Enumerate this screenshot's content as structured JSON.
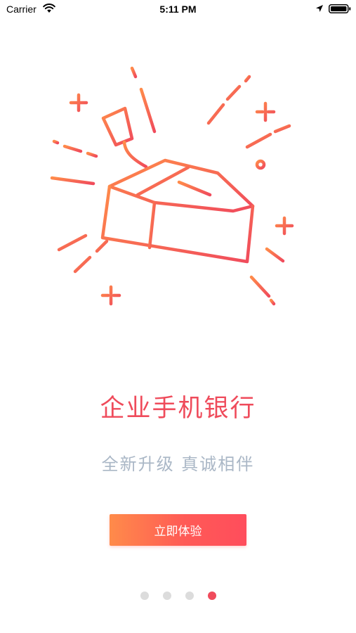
{
  "status_bar": {
    "carrier": "Carrier",
    "time": "5:11 PM",
    "icons": [
      "wifi-icon",
      "location-arrow-icon",
      "battery-icon"
    ]
  },
  "illustration": {
    "icon": "gift-box-burst-icon",
    "gradient": [
      "#ff8b4a",
      "#f04b5c"
    ]
  },
  "onboarding": {
    "title": "企业手机银行",
    "subtitle": "全新升级 真诚相伴",
    "cta_label": "立即体验"
  },
  "pager": {
    "page_count": 4,
    "current_page": 4
  },
  "colors": {
    "title": "#ef4b5b",
    "subtitle": "#aab7c6",
    "dot_inactive": "#dcdcdc",
    "dot_active": "#f04b5c"
  }
}
